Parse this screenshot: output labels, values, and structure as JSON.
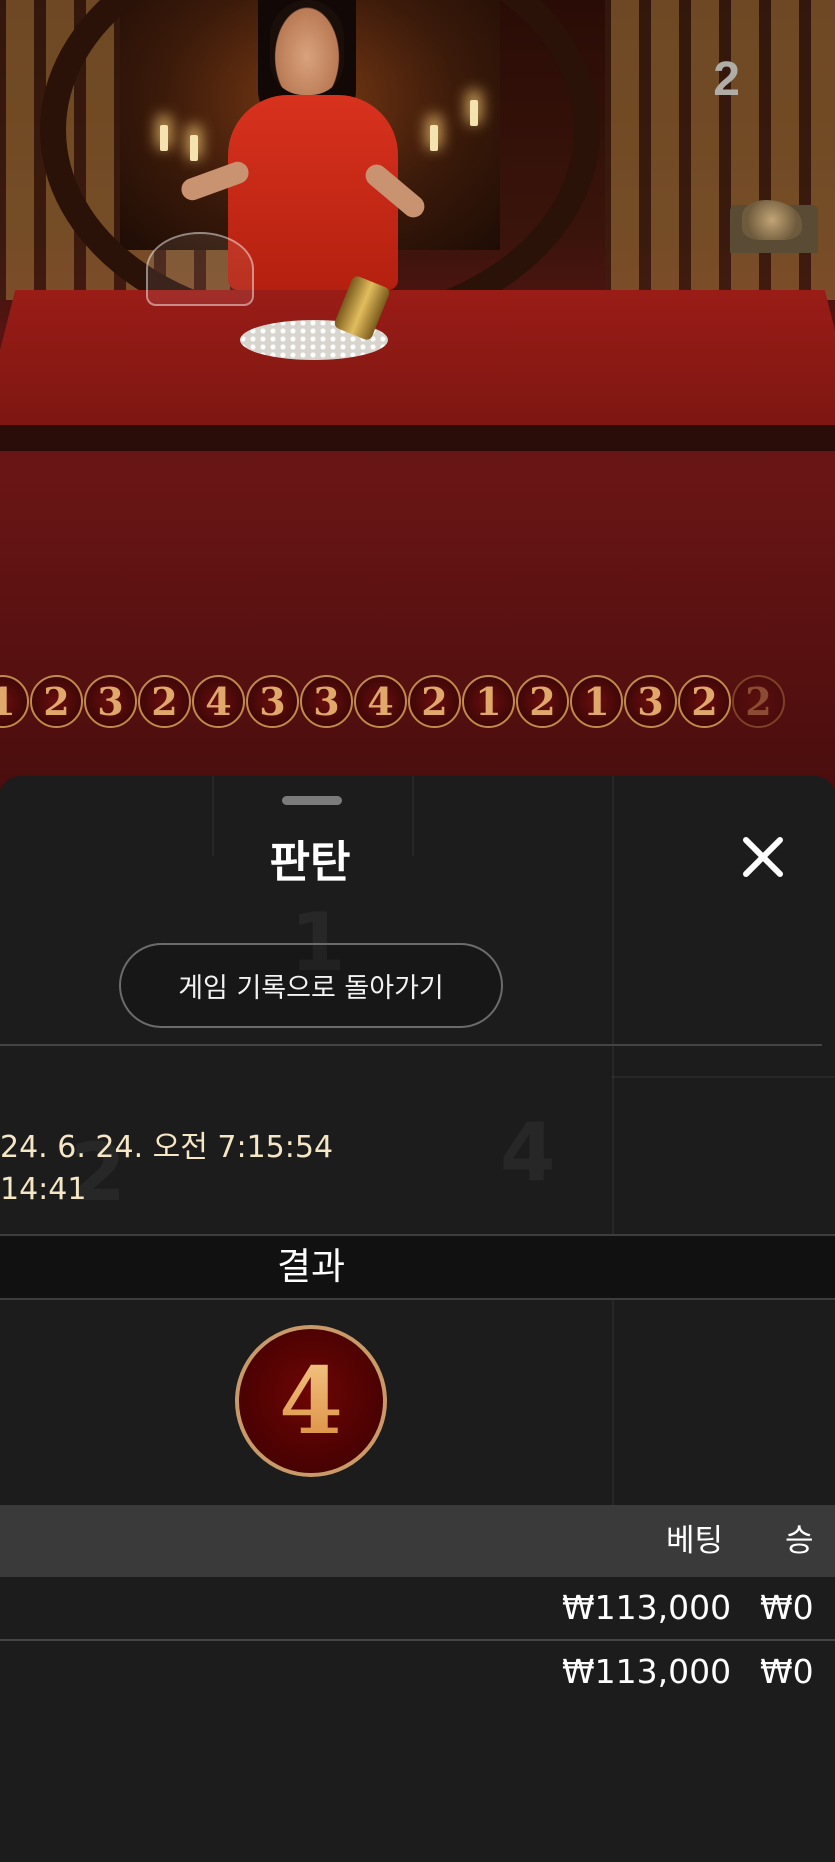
{
  "video": {
    "round_number": "2"
  },
  "history": [
    {
      "value": "1"
    },
    {
      "value": "2"
    },
    {
      "value": "3"
    },
    {
      "value": "2"
    },
    {
      "value": "4"
    },
    {
      "value": "3"
    },
    {
      "value": "3"
    },
    {
      "value": "4"
    },
    {
      "value": "2"
    },
    {
      "value": "1"
    },
    {
      "value": "2"
    },
    {
      "value": "1"
    },
    {
      "value": "3"
    },
    {
      "value": "2"
    },
    {
      "value": "2"
    }
  ],
  "sheet": {
    "title": "판탄",
    "back_button_label": "게임 기록으로 돌아가기",
    "datetime": "24. 6. 24. 오전 7:15:54",
    "round_id": "14:41",
    "result_label": "결과",
    "result_value": "4",
    "columns": {
      "bet": "베팅",
      "win": "승"
    },
    "rows": [
      {
        "bet": "₩113,000",
        "win": "₩0"
      },
      {
        "bet": "₩113,000",
        "win": "₩0"
      }
    ]
  },
  "colors": {
    "felt": "#8a1915",
    "sheet_bg": "#1c1c1c",
    "gold": "#e0a86a",
    "datetime_text": "#f5e6c5"
  }
}
